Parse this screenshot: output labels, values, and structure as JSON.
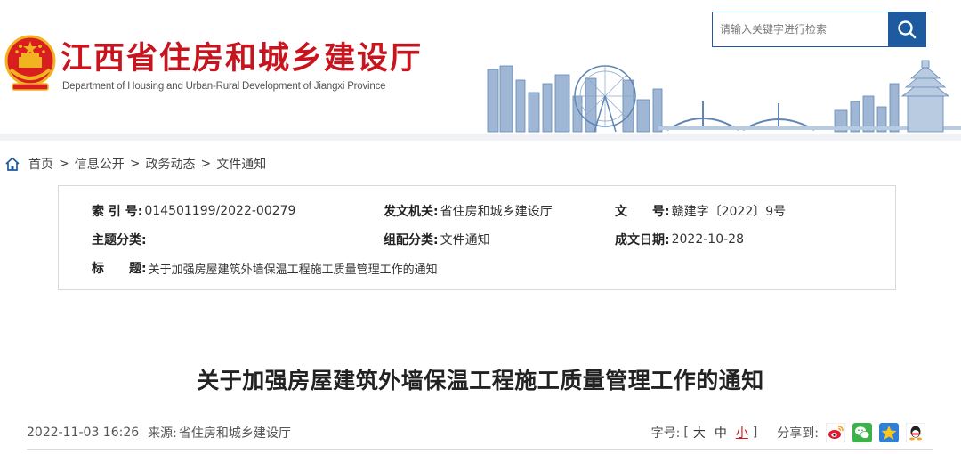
{
  "header": {
    "title": "江西省住房和城乡建设厅",
    "subtitle": "Department of Housing and Urban-Rural Development of Jiangxi Province",
    "search": {
      "placeholder": "请输入关键字进行检索"
    },
    "icons": {
      "emblem": "national-emblem-icon",
      "search": "search-icon",
      "skyline": "city-skyline-illustration"
    }
  },
  "breadcrumb": {
    "items": [
      "首页",
      "信息公开",
      "政务动态",
      "文件通知"
    ],
    "separator": ">"
  },
  "meta": {
    "index_label": "索 引 号:",
    "index_value": "014501199/2022-00279",
    "issuer_label": "发文机关:",
    "issuer_value": "省住房和城乡建设厅",
    "doc_no_label": "文　　号:",
    "doc_no_value": "赣建字〔2022〕9号",
    "topic_label": "主题分类:",
    "topic_value": "",
    "category_label": "组配分类:",
    "category_value": "文件通知",
    "date_label": "成文日期:",
    "date_value": "2022-10-28",
    "title_label": "标　　题:",
    "title_value": "关于加强房屋建筑外墙保温工程施工质量管理工作的通知"
  },
  "article": {
    "title": "关于加强房屋建筑外墙保温工程施工质量管理工作的通知",
    "datetime": "2022-11-03 16:26",
    "source_label": "来源:",
    "source_value": "省住房和城乡建设厅",
    "font_size_label": "字号:",
    "font_sizes": [
      "大",
      "中",
      "小"
    ],
    "bracket_open": "[",
    "bracket_close": "]",
    "share_label": "分享到:",
    "share_icons": [
      "weibo-icon",
      "wechat-icon",
      "qzone-icon",
      "qq-icon"
    ]
  },
  "colors": {
    "brand_red": "#c8141e",
    "brand_blue": "#1d5aa0"
  }
}
